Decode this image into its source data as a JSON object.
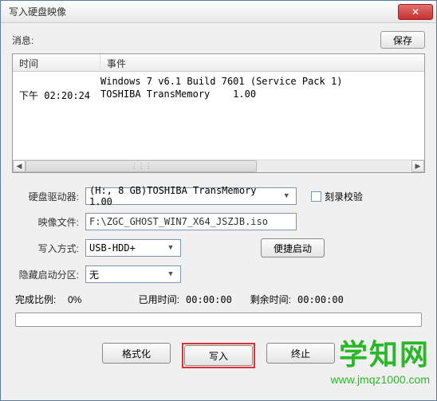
{
  "window": {
    "title": "写入硬盘映像"
  },
  "close_icon": "✕",
  "msg": {
    "label": "消息:",
    "save": "保存"
  },
  "table": {
    "headers": {
      "time": "时间",
      "event": "事件"
    },
    "rows": [
      {
        "time": "",
        "event": "Windows 7 v6.1 Build 7601 (Service Pack 1)"
      },
      {
        "time": "下午 02:20:24",
        "event": "TOSHIBA TransMemory    1.00"
      }
    ]
  },
  "form": {
    "drive_label": "硬盘驱动器:",
    "drive_value": "(H:, 8 GB)TOSHIBA TransMemory    1.00",
    "verify_label": "刻录校验",
    "image_label": "映像文件:",
    "image_value": "F:\\ZGC_GHOST_WIN7_X64_JSZJB.iso",
    "mode_label": "写入方式:",
    "mode_value": "USB-HDD+",
    "quick_boot": "便捷启动",
    "hide_label": "隐藏启动分区:",
    "hide_value": "无"
  },
  "progress": {
    "ratio_label": "完成比例:",
    "ratio_value": "0%",
    "elapsed_label": "已用时间:",
    "elapsed_value": "00:00:00",
    "remain_label": "剩余时间:",
    "remain_value": "00:00:00"
  },
  "buttons": {
    "format": "格式化",
    "write": "写入",
    "stop": "终止"
  },
  "watermark": {
    "text": "学知网",
    "url": "www.jmqz1000.com"
  },
  "arrows": {
    "left": "◀",
    "right": "▶",
    "down": "▼",
    "thumb": "⋮⋮⋮"
  }
}
